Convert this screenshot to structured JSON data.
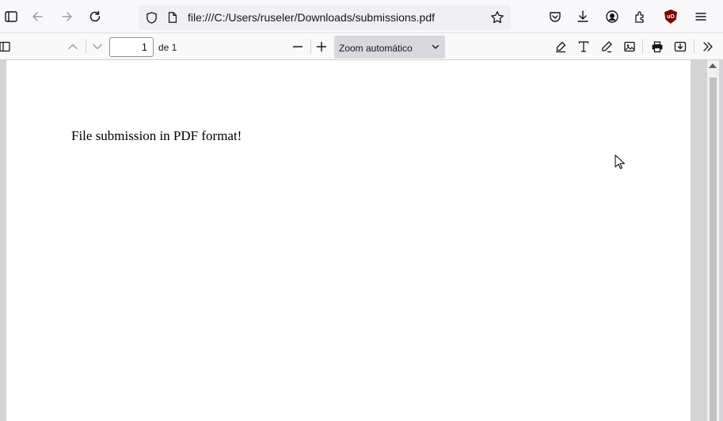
{
  "browser": {
    "url": "file:///C:/Users/ruseler/Downloads/submissions.pdf",
    "icons": [
      "sidebar-icon",
      "back-icon",
      "forward-icon",
      "reload-icon",
      "shield-icon",
      "page-icon",
      "star-icon",
      "pocket-icon",
      "download-icon",
      "account-icon",
      "extensions-icon",
      "ublock-icon",
      "menu-icon"
    ],
    "ublock_badge": "uO"
  },
  "pdf_toolbar": {
    "page_number": "1",
    "page_of": "de 1",
    "zoom": "Zoom automático",
    "icons": [
      "sidebar-toggle-icon",
      "prev-page-icon",
      "next-page-icon",
      "zoom-out-icon",
      "zoom-in-icon",
      "highlight-icon",
      "text-icon",
      "draw-icon",
      "image-icon",
      "print-icon",
      "save-icon",
      "more-tools-icon"
    ]
  },
  "document": {
    "text": "File submission in PDF format!"
  }
}
